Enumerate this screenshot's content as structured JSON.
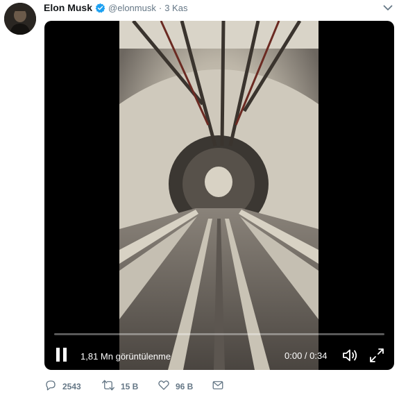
{
  "tweet": {
    "author_name": "Elon Musk",
    "handle": "@elonmusk",
    "separator": "·",
    "time": "3 Kas",
    "verified": true
  },
  "video": {
    "views": "1,81 Mn görüntülenme",
    "timecode": "0:00 / 0:34",
    "progress": 0.0,
    "state": "playing",
    "icons": [
      "pause-icon",
      "volume-icon",
      "fullscreen-icon"
    ]
  },
  "actions": {
    "replies": "2543",
    "retweets": "15 B",
    "likes": "96 B",
    "icons": [
      "reply-icon",
      "retweet-icon",
      "like-icon",
      "direct-message-icon"
    ]
  },
  "colors": {
    "text": "#14171a",
    "secondary": "#657786",
    "verified": "#1da1f2",
    "media_bg": "#000000"
  }
}
